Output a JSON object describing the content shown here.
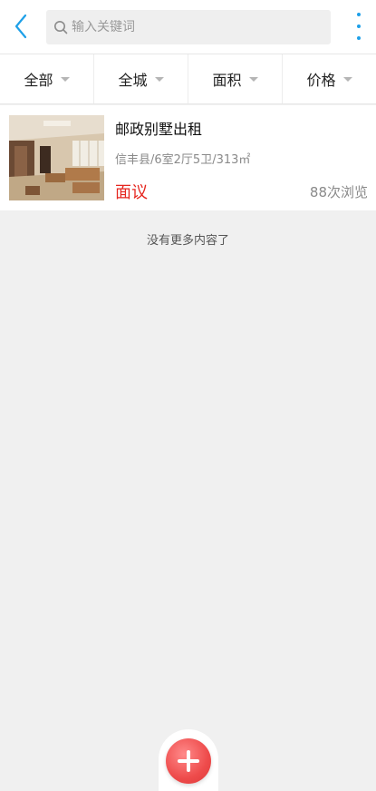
{
  "header": {
    "search": {
      "placeholder": "输入关键词",
      "value": ""
    },
    "back_icon": "chevron-left-icon",
    "more_icon": "vertical-dots-icon"
  },
  "filters": [
    {
      "label": "全部"
    },
    {
      "label": "全城"
    },
    {
      "label": "面积"
    },
    {
      "label": "价格"
    }
  ],
  "listings": [
    {
      "title": "邮政别墅出租",
      "meta": "信丰县/6室2厅5卫/313㎡",
      "price": "面议",
      "views": "88次浏览"
    }
  ],
  "footer_note": "没有更多内容了",
  "fab_icon": "plus-icon",
  "colors": {
    "accent": "#1ea0e8",
    "price": "#e5261f",
    "fab": "#ee4b4b"
  }
}
